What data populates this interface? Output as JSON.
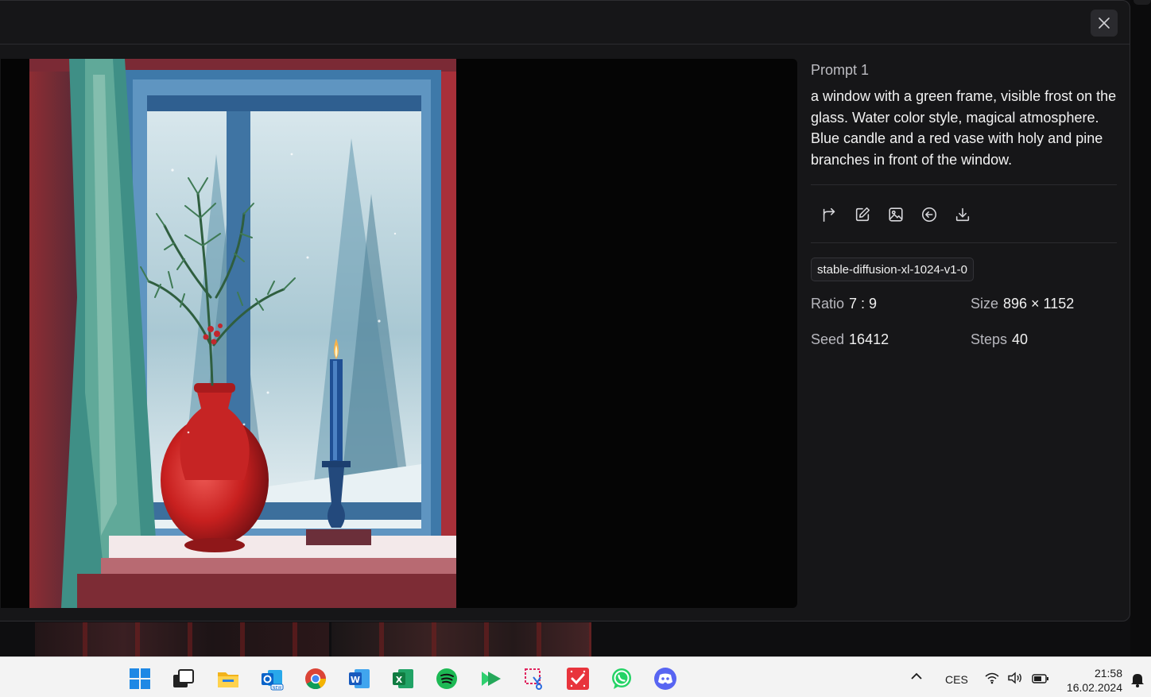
{
  "dialog": {
    "close_icon": "close-icon",
    "prompt_title": "Prompt 1",
    "prompt_text": "a window with a green frame, visible frost on the glass. Water color style, magical atmosphere. Blue candle and a red vase with holy and pine branches in front of the window.",
    "actions": [
      {
        "name": "remix-icon"
      },
      {
        "name": "edit-icon"
      },
      {
        "name": "image-icon"
      },
      {
        "name": "back-arrow-icon"
      },
      {
        "name": "download-icon"
      }
    ],
    "model": "stable-diffusion-xl-1024-v1-0",
    "params": {
      "ratio_label": "Ratio",
      "ratio_value": "7 : 9",
      "size_label": "Size",
      "size_value": "896 × 1152",
      "seed_label": "Seed",
      "seed_value": "16412",
      "steps_label": "Steps",
      "steps_value": "40"
    }
  },
  "taskbar": {
    "apps": [
      "start",
      "task-view",
      "file-explorer",
      "outlook-new",
      "chrome",
      "word",
      "excel",
      "spotify",
      "app-green-arrow",
      "snipping-tool",
      "app-red-todo",
      "whatsapp",
      "discord"
    ],
    "tray_chevron": "chevron-up-icon",
    "language": "CES",
    "time": "21:58",
    "date": "16.02.2024"
  }
}
